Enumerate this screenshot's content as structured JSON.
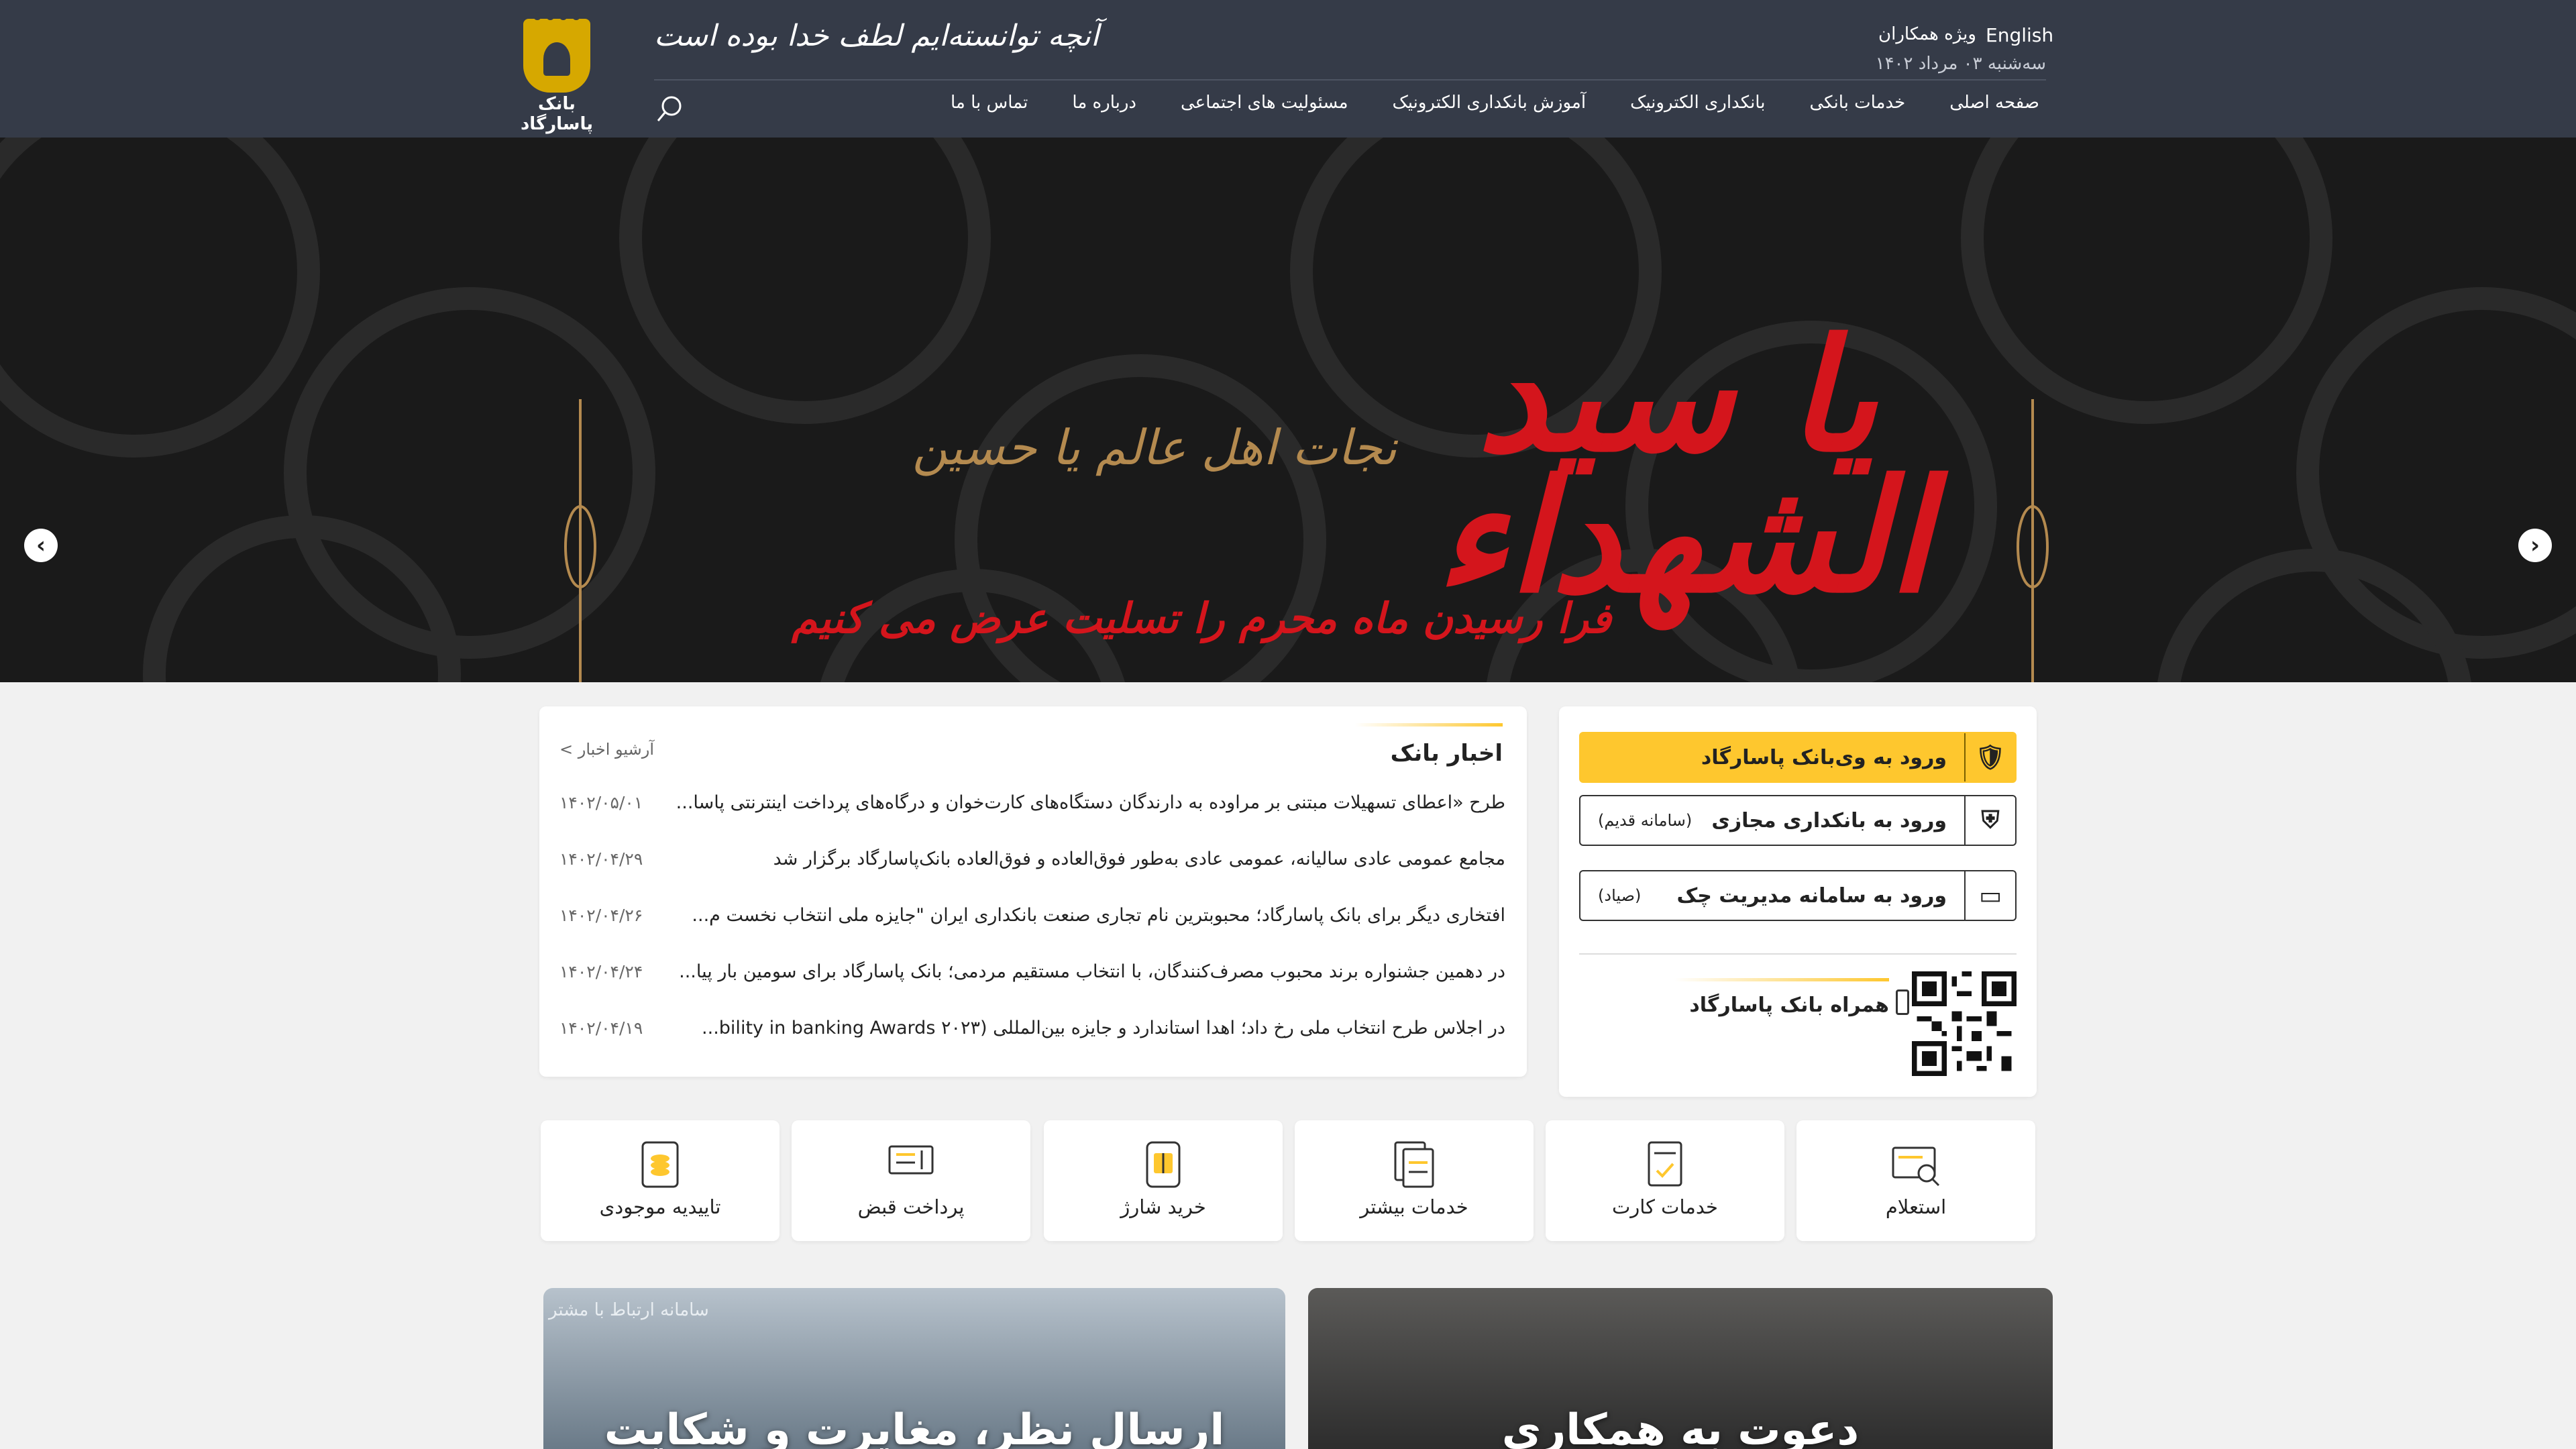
{
  "header": {
    "logo_text": "بانک پاسارگاد",
    "slogan": "آنچه توانسته‌ایم لطف خدا بوده است",
    "lang_link": "English",
    "partners_link": "ویژه همکاران",
    "date": "سه‌شنبه ۰۳ مرداد ۱۴۰۲",
    "nav": [
      "صفحه اصلی",
      "خدمات بانکی",
      "بانکداری الکترونیک",
      "آموزش بانکداری الکترونیک",
      "مسئولیت های اجتماعی",
      "درباره ما",
      "تماس با ما"
    ]
  },
  "hero": {
    "main_text": "یا سید الشهداء",
    "sub_text": "نجات اهل عالم یا حسین",
    "caption": "فرا رسیدن ماه محرم را تسلیت عرض می کنیم",
    "dots": 7,
    "active_dot": 6
  },
  "login": {
    "web": {
      "label": "ورود به وی‌بانک پاسارگاد",
      "icon": "shield-check-icon"
    },
    "virtual": {
      "label": "ورود به بانکداری مجازی",
      "note": "(سامانه قدیم)",
      "icon": "shield-icon"
    },
    "check": {
      "label": "ورود به سامانه مدیریت چک",
      "note": "(صیاد)",
      "icon": "check-card-icon"
    },
    "mobile_title": "همراه بانک پاسارگاد"
  },
  "news": {
    "title": "اخبار بانک",
    "archive": "آرشیو اخبار",
    "items": [
      {
        "title": "طرح «اعطای تسهیلات مبتنی بر مراوده به دارندگان دستگاه‌های کارت‌خوان و درگاه‌های پرداخت اینترنتی پاسا...",
        "date": "۱۴۰۲/۰۵/۰۱"
      },
      {
        "title": "مجامع عمومی عادی سالیانه، عمومی عادی به‌طور فوق‌العاده و فوق‌العاده بانک‌پاسارگاد برگزار شد",
        "date": "۱۴۰۲/۰۴/۲۹"
      },
      {
        "title": "افتخاری دیگر برای بانک پاسارگاد؛ محبوبترین نام تجاری صنعت بانکداری ایران \"جایزه ملی انتخاب نخست م...",
        "date": "۱۴۰۲/۰۴/۲۶"
      },
      {
        "title": "در دهمین جشنواره برند محبوب مصرف‌کنندگان، با انتخاب مستقیم مردمی؛ بانک پاسارگاد برای سومین بار پیا...",
        "date": "۱۴۰۲/۰۴/۲۴"
      },
      {
        "title": "در اجلاس طرح انتخاب ملی رخ داد؛ اهدا استاندارد و جایزه بین‌المللی (bility in banking Awards ۲۰۲۳...",
        "date": "۱۴۰۲/۰۴/۱۹"
      }
    ]
  },
  "services": [
    {
      "label": "استعلام",
      "icon": "inquiry-icon"
    },
    {
      "label": "خدمات کارت",
      "icon": "card-services-icon"
    },
    {
      "label": "خدمات بیشتر",
      "icon": "more-services-icon"
    },
    {
      "label": "خرید شارژ",
      "icon": "charge-icon"
    },
    {
      "label": "پرداخت قبض",
      "icon": "bill-icon"
    },
    {
      "label": "تاییدیه موجودی",
      "icon": "balance-icon"
    }
  ],
  "banners": {
    "coop": "دعوت به همکاری",
    "complaint": "ارسال نظر، مغایرت و شکایت",
    "complaint_small": "سامانه ارتباط با مشتر"
  },
  "colors": {
    "header_bg": "#353b48",
    "accent": "#fec72e",
    "hero_red": "#d4151c",
    "gold": "#d6a800"
  }
}
